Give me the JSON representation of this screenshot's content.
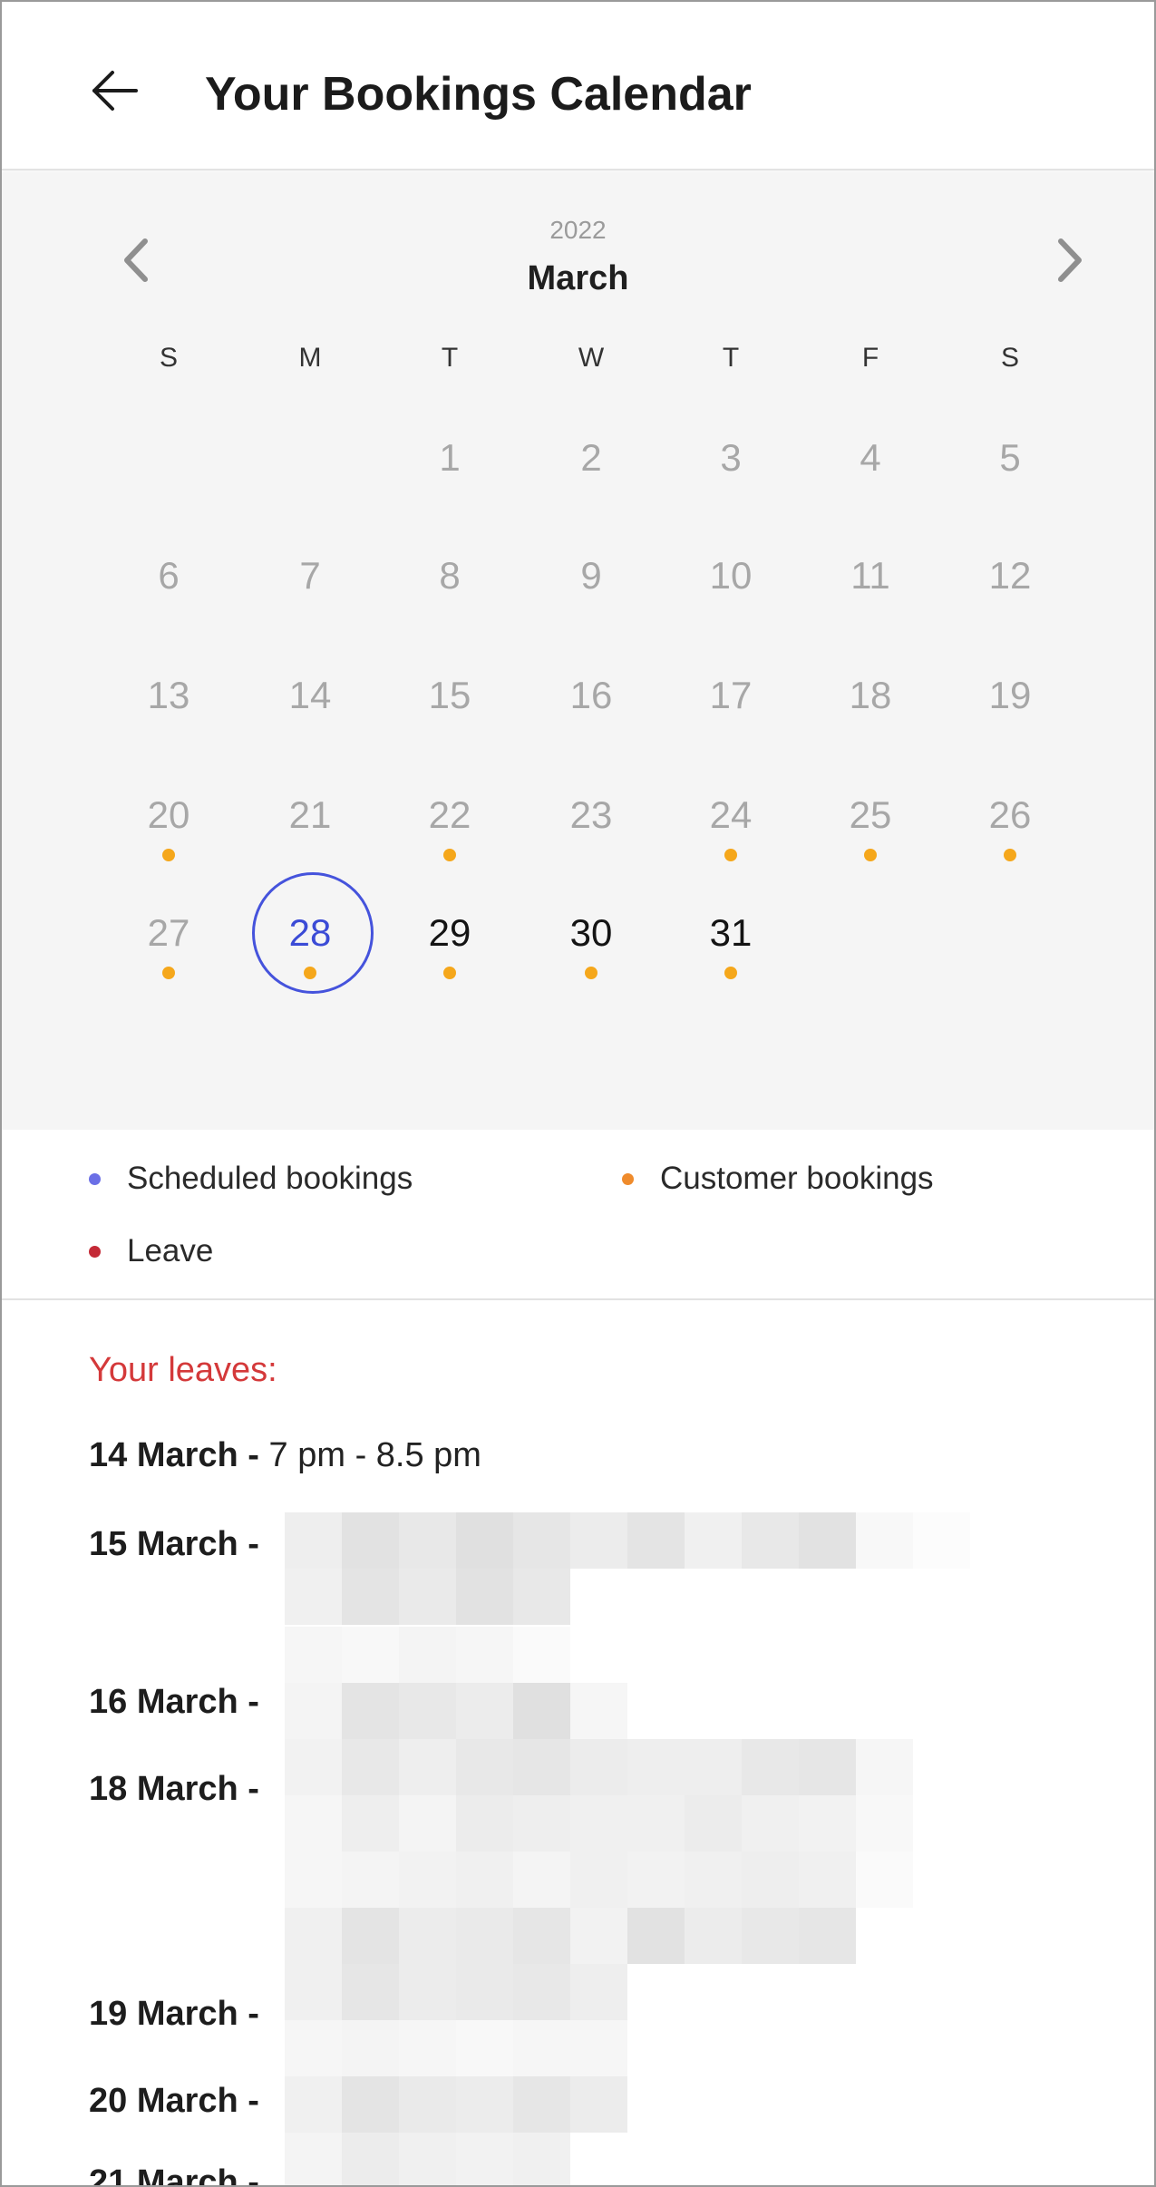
{
  "header": {
    "title": "Your Bookings Calendar"
  },
  "calendar": {
    "year": "2022",
    "month": "March",
    "weekdays": [
      "S",
      "M",
      "T",
      "W",
      "T",
      "F",
      "S"
    ],
    "rows": [
      [
        "",
        "",
        "1",
        "2",
        "3",
        "4",
        "5"
      ],
      [
        "6",
        "7",
        "8",
        "9",
        "10",
        "11",
        "12"
      ],
      [
        "13",
        "14",
        "15",
        "16",
        "17",
        "18",
        "19"
      ],
      [
        "20",
        "21",
        "22",
        "23",
        "24",
        "25",
        "26"
      ],
      [
        "27",
        "28",
        "29",
        "30",
        "31",
        "",
        ""
      ]
    ],
    "selected_day": "28",
    "days_with_customer_bookings": [
      "20",
      "22",
      "24",
      "25",
      "26",
      "27",
      "28",
      "29",
      "30",
      "31"
    ],
    "customer_booking_dot_color": "#f5a71b",
    "selected_ring_color": "#4553dc"
  },
  "legend": {
    "scheduled": {
      "label": "Scheduled bookings",
      "color": "#6b6fe6"
    },
    "customer": {
      "label": "Customer bookings",
      "color": "#ef8b2c"
    },
    "leave": {
      "label": "Leave",
      "color": "#c42a36"
    }
  },
  "leaves": {
    "heading": "Your leaves:",
    "heading_color": "#d4393a",
    "items": [
      {
        "date": "14 March -",
        "time": "7 pm - 8.5 pm"
      },
      {
        "date": "15 March -",
        "time": ""
      },
      {
        "date": "16 March -",
        "time": ""
      },
      {
        "date": "18 March -",
        "time": ""
      },
      {
        "date": "19 March -",
        "time": ""
      },
      {
        "date": "20 March -",
        "time": ""
      },
      {
        "date": "21 March -",
        "time": ""
      }
    ]
  }
}
